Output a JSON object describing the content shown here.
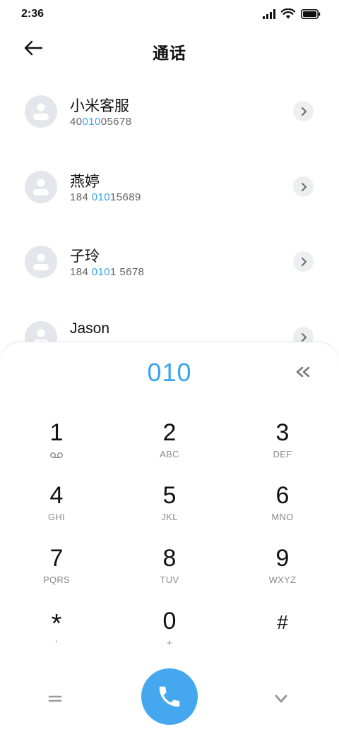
{
  "status_bar": {
    "time": "2:36",
    "icons": [
      "signal-icon",
      "wifi-icon",
      "battery-icon"
    ]
  },
  "header": {
    "title": "通话",
    "back_icon": "arrow-left-icon"
  },
  "contacts": [
    {
      "name": "小米客服",
      "number_pre": "40",
      "number_match": "010",
      "number_post": "05678"
    },
    {
      "name": "燕婷",
      "number_pre": "184 ",
      "number_match": "010",
      "number_post": "15689"
    },
    {
      "name": "子玲",
      "number_pre": "184 ",
      "number_match": "010",
      "number_post": "1 5678"
    },
    {
      "name": "Jason",
      "number_pre": "",
      "number_match": "",
      "number_post": ""
    }
  ],
  "dialpad": {
    "dialed": "010",
    "keys": [
      {
        "digit": "1",
        "sub": ""
      },
      {
        "digit": "2",
        "sub": "ABC"
      },
      {
        "digit": "3",
        "sub": "DEF"
      },
      {
        "digit": "4",
        "sub": "GHI"
      },
      {
        "digit": "5",
        "sub": "JKL"
      },
      {
        "digit": "6",
        "sub": "MNO"
      },
      {
        "digit": "7",
        "sub": "PQRS"
      },
      {
        "digit": "8",
        "sub": "TUV"
      },
      {
        "digit": "9",
        "sub": "WXYZ"
      },
      {
        "digit": "*",
        "sub": ","
      },
      {
        "digit": "0",
        "sub": "+"
      },
      {
        "digit": "#",
        "sub": ""
      }
    ]
  },
  "colors": {
    "accent": "#3aa4ec",
    "call_button": "#45a8ef",
    "avatar_bg": "#e3e6ea"
  }
}
